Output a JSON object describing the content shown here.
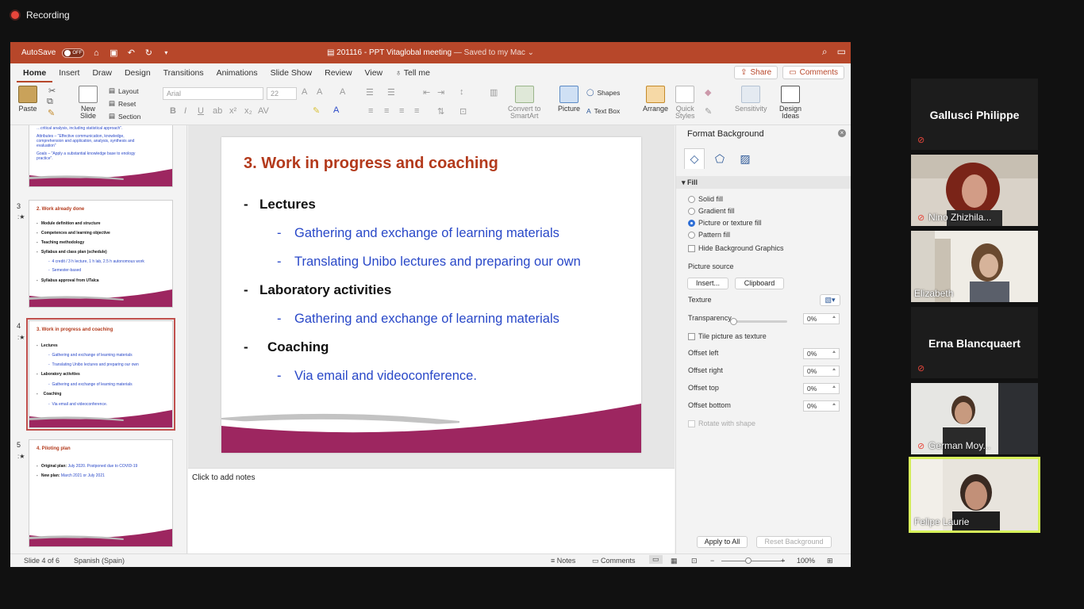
{
  "recording": {
    "label": "Recording"
  },
  "titlebar": {
    "autosave_label": "AutoSave",
    "autosave_state": "OFF",
    "document_title": "201116 - PPT Vitaglobal meeting",
    "save_status": "— Saved to my Mac ⌄"
  },
  "tabs": [
    "Home",
    "Insert",
    "Draw",
    "Design",
    "Transitions",
    "Animations",
    "Slide Show",
    "Review",
    "View"
  ],
  "tell_me": "Tell me",
  "share_label": "Share",
  "comments_label": "Comments",
  "ribbon": {
    "paste": "Paste",
    "new_slide_line1": "New",
    "new_slide_line2": "Slide",
    "layout": "Layout",
    "reset": "Reset",
    "section": "Section",
    "font_name": "Arial",
    "font_size": "22",
    "convert_line1": "Convert to",
    "convert_line2": "SmartArt",
    "picture": "Picture",
    "shapes": "Shapes",
    "text_box": "Text Box",
    "arrange": "Arrange",
    "quick_styles_line1": "Quick",
    "quick_styles_line2": "Styles",
    "sensitivity": "Sensitivity",
    "design_ideas_line1": "Design",
    "design_ideas_line2": "Ideas"
  },
  "thumbnails": {
    "slide2_partial": {
      "lines": [
        "…critical analysis, including statistical approach\".",
        "Attributes – \"Effective communication, knowledge,",
        "comprehension and application, analysis, synthesis and",
        "evaluation\"",
        "Goals – \"Apply a substantial knowledge base to enology",
        "practice\"."
      ]
    },
    "slide3": {
      "number": "3",
      "title": "2. Work already done",
      "items": [
        "Module definition and structure",
        "Competences and learning objective",
        "Teaching methodology",
        "Syllabus and class plan (schedule)",
        "4 credit / 3 h lecture, 1 h lab, 2.5 h autonomous work",
        "Semester-based",
        "Syllabus approval from UTalca"
      ]
    },
    "slide4": {
      "number": "4",
      "title": "3. Work in progress and  coaching",
      "items": [
        "Lectures",
        "Gathering and exchange of learning materials",
        "Translating Unibo lectures and preparing our own",
        "Laboratory activities",
        "Gathering and exchange of learning materials",
        "Coaching",
        "Via email and videoconference."
      ]
    },
    "slide5": {
      "number": "5",
      "title": "4. Piloting plan",
      "items": [
        {
          "label": "Original plan:",
          "value": "July 2020. Postponed due to COVID-19"
        },
        {
          "label": "New plan:",
          "value": "March 2021 or July 2021"
        }
      ]
    }
  },
  "slide": {
    "title": "3. Work in progress and  coaching",
    "bullet1": "Lectures",
    "sub1a": "Gathering and exchange of learning materials",
    "sub1b": "Translating Unibo lectures and preparing our own",
    "bullet2": "Laboratory activities",
    "sub2a": "Gathering and exchange of learning materials",
    "bullet3": "Coaching",
    "sub3a": "Via email and videoconference.",
    "dash": "-"
  },
  "notes_placeholder": "Click to add notes",
  "format_panel": {
    "title": "Format Background",
    "fill_section": "Fill",
    "solid": "Solid fill",
    "gradient": "Gradient fill",
    "picture": "Picture or texture fill",
    "pattern": "Pattern fill",
    "hide_bg": "Hide Background Graphics",
    "picture_source": "Picture source",
    "insert_btn": "Insert...",
    "clipboard_btn": "Clipboard",
    "texture": "Texture",
    "transparency": "Transparency",
    "transparency_value": "0%",
    "tile": "Tile picture as texture",
    "offset_left": "Offset left",
    "offset_left_value": "0%",
    "offset_right": "Offset right",
    "offset_right_value": "0%",
    "offset_top": "Offset top",
    "offset_top_value": "0%",
    "offset_bottom": "Offset bottom",
    "offset_bottom_value": "0%",
    "rotate": "Rotate with shape",
    "apply_all": "Apply to All",
    "reset_bg": "Reset Background"
  },
  "status": {
    "slide_info": "Slide 4 of 6",
    "language": "Spanish (Spain)",
    "notes": "Notes",
    "comments": "Comments",
    "zoom": "100%"
  },
  "participants": [
    {
      "name": "Gallusci Philippe",
      "video": false
    },
    {
      "name": "Nino Zhizhila...",
      "video": true
    },
    {
      "name": "Elizabeth",
      "video": true
    },
    {
      "name": "Erna Blancquaert",
      "video": false
    },
    {
      "name": "German Moy...",
      "video": true
    },
    {
      "name": "Felipe Laurie",
      "video": true,
      "active_speaker": true
    }
  ],
  "colors": {
    "accent": "#b7472a",
    "slide_title": "#b33a1c",
    "bullet_blue": "#2948c8",
    "speaker_highlight": "#d7f25a",
    "recording": "#e8463b"
  }
}
